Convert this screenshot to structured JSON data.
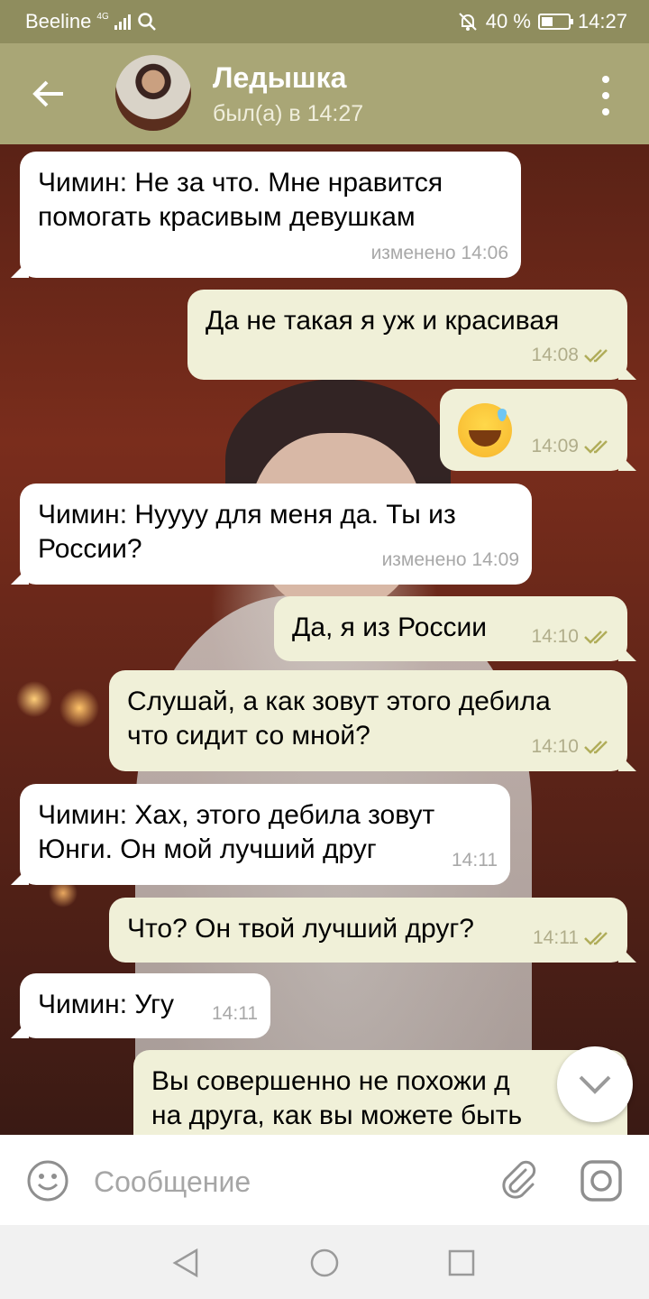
{
  "status_bar": {
    "carrier": "Beeline",
    "network": "4G",
    "battery": "40 %",
    "time": "14:27"
  },
  "header": {
    "contact_name": "Ледышка",
    "contact_status": "был(а) в 14:27"
  },
  "messages": [
    {
      "direction": "in",
      "text_lines": [
        "Чимин: Не за что. Мне нравится",
        "помогать красивым девушкам"
      ],
      "meta": "изменено 14:06"
    },
    {
      "direction": "out",
      "text_lines": [
        "Да не такая я уж и красивая"
      ],
      "meta": "14:08",
      "read": true
    },
    {
      "direction": "out",
      "emoji": "grinning-face-with-sweat",
      "meta": "14:09",
      "read": true
    },
    {
      "direction": "in",
      "text_lines": [
        "Чимин: Нуууу для меня да. Ты из",
        "России?"
      ],
      "meta": "изменено 14:09"
    },
    {
      "direction": "out",
      "text_lines": [
        "Да, я из России"
      ],
      "meta": "14:10",
      "read": true
    },
    {
      "direction": "out",
      "text_lines": [
        "Слушай, а как зовут этого дебила",
        "что сидит со мной?"
      ],
      "meta": "14:10",
      "read": true
    },
    {
      "direction": "in",
      "text_lines": [
        "Чимин: Хах, этого дебила зовут",
        "Юнги. Он мой лучший друг"
      ],
      "meta": "14:11"
    },
    {
      "direction": "out",
      "text_lines": [
        "Что? Он твой лучший друг?"
      ],
      "meta": "14:11",
      "read": true
    },
    {
      "direction": "in",
      "text_lines": [
        "Чимин: Угу"
      ],
      "meta": "14:11"
    },
    {
      "direction": "out",
      "text_lines": [
        "Вы совершенно не похожи д",
        "на друга, как вы можете быть"
      ],
      "meta": ""
    }
  ],
  "composer": {
    "placeholder": "Сообщение"
  },
  "colors": {
    "status_bar": "#8f8d5e",
    "header": "#a9a676",
    "incoming_bubble": "#ffffff",
    "outgoing_bubble": "#f0f0d8",
    "read_check": "#b0ad5a"
  }
}
